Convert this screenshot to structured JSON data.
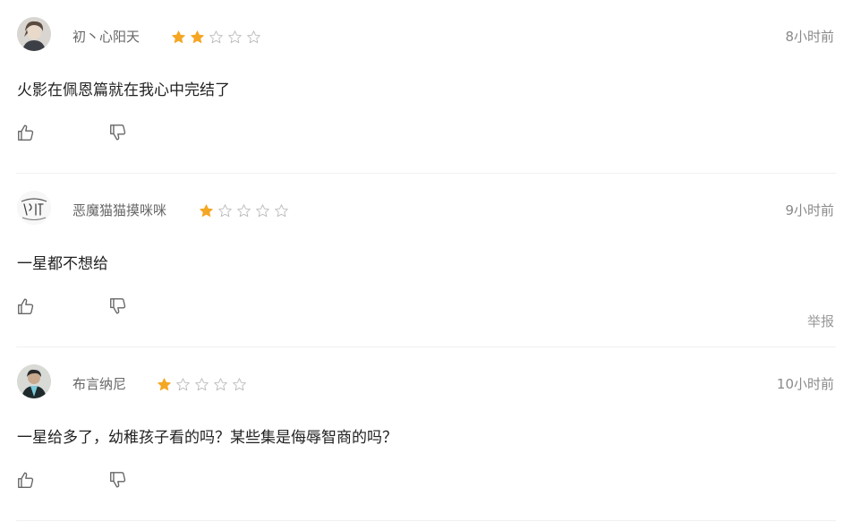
{
  "colors": {
    "star_filled": "#f5a623",
    "star_empty": "#bbbbbb",
    "username": "#666666",
    "time": "#8a8a8a",
    "divider": "#f0f0f0"
  },
  "reviews": [
    {
      "username": "初丶心阳天",
      "rating": 2,
      "max_rating": 5,
      "time": "8小时前",
      "content": "火影在佩恩篇就在我心中完结了",
      "like_icon": "thumbs-up-icon",
      "dislike_icon": "thumbs-down-icon"
    },
    {
      "username": "恶魔猫猫摸咪咪",
      "rating": 1,
      "max_rating": 5,
      "time": "9小时前",
      "content": "一星都不想给",
      "report": "举报",
      "like_icon": "thumbs-up-icon",
      "dislike_icon": "thumbs-down-icon"
    },
    {
      "username": "布言纳尼",
      "rating": 1,
      "max_rating": 5,
      "time": "10小时前",
      "content": "一星给多了，幼稚孩子看的吗？某些集是侮辱智商的吗？",
      "like_icon": "thumbs-up-icon",
      "dislike_icon": "thumbs-down-icon"
    }
  ]
}
